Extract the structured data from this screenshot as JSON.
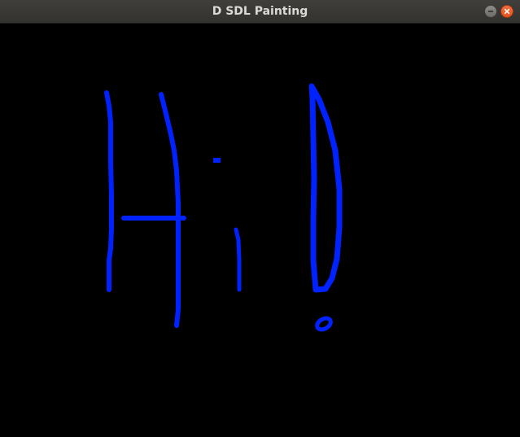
{
  "window": {
    "title": "D SDL Painting"
  },
  "controls": {
    "minimize_icon": "minimize-icon",
    "close_icon": "close-icon"
  },
  "colors": {
    "titlebar": "#3c3b37",
    "title_text": "#dcdad5",
    "canvas_background": "#000000",
    "brush": "#0022ff",
    "close_button": "#e95420"
  }
}
